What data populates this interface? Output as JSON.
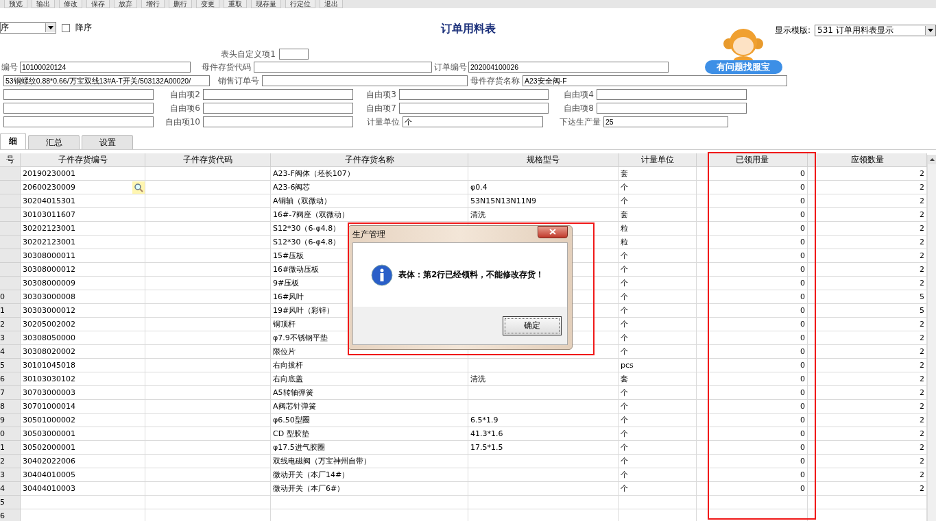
{
  "toolbar": [
    "预览",
    "输出",
    "修改",
    "保存",
    "放弃",
    "增行",
    "删行",
    "变更",
    "重取",
    "现存量",
    "行定位",
    "退出"
  ],
  "sort": {
    "value": "序"
  },
  "descending": {
    "label": "降序",
    "checked": false
  },
  "title": "订单用料表",
  "template": {
    "label": "显示模版:",
    "value": "531 订单用料表显示"
  },
  "help_button": "有问题找服宝",
  "header_fields": [
    [
      {
        "kind": "labeled",
        "label": "表头自定义项1"
      }
    ],
    [
      {
        "kind": "labeled",
        "label": "编号",
        "value": "10100020124"
      },
      {
        "kind": "labeled",
        "label": "母件存货代码"
      },
      {
        "kind": "labeled",
        "label": "订单编号",
        "value": "202004100026"
      }
    ],
    [
      {
        "kind": "bare",
        "value": "53铜螺纹0.88*0.66/万宝双线13#A-T开关/503132A00020/"
      },
      {
        "kind": "labeled",
        "label": "销售订单号"
      },
      {
        "kind": "labeled",
        "label": "母件存货名称",
        "value": "A23安全阀-F"
      }
    ],
    [
      {
        "kind": "bare"
      },
      {
        "kind": "labeled",
        "label": "自由项2"
      },
      {
        "kind": "labeled",
        "label": "自由项3"
      },
      {
        "kind": "labeled",
        "label": "自由项4"
      }
    ],
    [
      {
        "kind": "bare"
      },
      {
        "kind": "labeled",
        "label": "自由项6"
      },
      {
        "kind": "labeled",
        "label": "自由项7"
      },
      {
        "kind": "labeled",
        "label": "自由项8"
      }
    ],
    [
      {
        "kind": "bare"
      },
      {
        "kind": "labeled",
        "label": "自由项10"
      },
      {
        "kind": "labeled",
        "label": "计量单位",
        "value": "个"
      },
      {
        "kind": "labeled",
        "label": "下达生产量",
        "value": "25"
      }
    ]
  ],
  "tabs": [
    {
      "label": "细",
      "selected": true
    },
    {
      "label": "汇总",
      "selected": false
    },
    {
      "label": "设置",
      "selected": false
    }
  ],
  "table": {
    "columns": [
      "号",
      "子件存货编号",
      "子件存货代码",
      "子件存货名称",
      "规格型号",
      "计量单位",
      "已领用量",
      "应领数量"
    ],
    "rows": [
      {
        "code": "20190230001",
        "name": "A23-F阀体（坯长107）",
        "unit": "套",
        "issued": "0",
        "required": "2",
        "lookup": false
      },
      {
        "code": "20600230009",
        "name": "A23-6阀芯",
        "spec": "φ0.4",
        "unit": "个",
        "issued": "0",
        "required": "2",
        "lookup": true
      },
      {
        "code": "30204015301",
        "name": "A铜轴（双微动）",
        "spec": "53N15N13N11N9",
        "unit": "个",
        "issued": "0",
        "required": "2",
        "lookup": false
      },
      {
        "code": "30103011607",
        "name": "16#-7阀座（双微动）",
        "spec": "清洗",
        "unit": "套",
        "issued": "0",
        "required": "2",
        "lookup": false
      },
      {
        "code": "30202123001",
        "name": "S12*30（6-φ4.8）",
        "unit": "粒",
        "issued": "0",
        "required": "2",
        "lookup": false
      },
      {
        "code": "30202123001",
        "name": "S12*30（6-φ4.8）",
        "unit": "粒",
        "issued": "0",
        "required": "2",
        "lookup": false
      },
      {
        "code": "30308000011",
        "name": "15#压板",
        "unit": "个",
        "issued": "0",
        "required": "2",
        "lookup": false
      },
      {
        "code": "30308000012",
        "name": "16#微动压板",
        "unit": "个",
        "issued": "0",
        "required": "2",
        "lookup": false
      },
      {
        "code": "30308000009",
        "name": "9#压板",
        "unit": "个",
        "issued": "0",
        "required": "2",
        "lookup": false
      },
      {
        "row_number": "0",
        "code": "30303000008",
        "name": "16#风叶",
        "unit": "个",
        "issued": "0",
        "required": "5",
        "lookup": false
      },
      {
        "row_number": "1",
        "code": "30303000012",
        "name": "19#风叶（彩锌）",
        "unit": "个",
        "issued": "0",
        "required": "5",
        "lookup": false
      },
      {
        "row_number": "2",
        "code": "30205002002",
        "name": "铜顶杆",
        "unit": "个",
        "issued": "0",
        "required": "2",
        "lookup": false
      },
      {
        "row_number": "3",
        "code": "30308050000",
        "name": "φ7.9不锈钢平垫",
        "unit": "个",
        "issued": "0",
        "required": "2",
        "lookup": false
      },
      {
        "row_number": "4",
        "code": "30308020002",
        "name": "限位片",
        "unit": "个",
        "issued": "0",
        "required": "2",
        "lookup": false
      },
      {
        "row_number": "5",
        "code": "30101045018",
        "name": "右向拔杆",
        "unit": "pcs",
        "issued": "0",
        "required": "2",
        "lookup": false
      },
      {
        "row_number": "6",
        "code": "30103030102",
        "name": "右向底盖",
        "spec": "清洗",
        "unit": "套",
        "issued": "0",
        "required": "2",
        "lookup": false
      },
      {
        "row_number": "7",
        "code": "30703000003",
        "name": "A5转轴弹簧",
        "unit": "个",
        "issued": "0",
        "required": "2",
        "lookup": false
      },
      {
        "row_number": "8",
        "code": "30701000014",
        "name": "A阀芯针弹簧",
        "unit": "个",
        "issued": "0",
        "required": "2",
        "lookup": false
      },
      {
        "row_number": "9",
        "code": "30501000002",
        "name": "φ6.50型圈",
        "spec": "6.5*1.9",
        "unit": "个",
        "issued": "0",
        "required": "2",
        "lookup": false
      },
      {
        "row_number": "0",
        "code": "30503000001",
        "name": "CD 型胶垫",
        "spec": "41.3*1.6",
        "unit": "个",
        "issued": "0",
        "required": "2",
        "lookup": false
      },
      {
        "row_number": "1",
        "code": "30502000001",
        "name": "φ17.5进气胶圈",
        "spec": "17.5*1.5",
        "unit": "个",
        "issued": "0",
        "required": "2",
        "lookup": false
      },
      {
        "row_number": "2",
        "code": "30402022006",
        "name": "双线电磁阀（万宝神州自带）",
        "unit": "个",
        "issued": "0",
        "required": "2",
        "lookup": false
      },
      {
        "row_number": "3",
        "code": "30404010005",
        "name": "微动开关（本厂14#）",
        "unit": "个",
        "issued": "0",
        "required": "2",
        "lookup": false
      },
      {
        "row_number": "4",
        "code": "30404010003",
        "name": "微动开关（本厂6#）",
        "unit": "个",
        "issued": "0",
        "required": "2",
        "lookup": false
      },
      {
        "row_number": "5",
        "lookup": false
      },
      {
        "row_number": "6",
        "lookup": false
      }
    ]
  },
  "dialog": {
    "title": "生产管理",
    "message": "表体：第2行已经领料，不能修改存货！",
    "button": "确定"
  }
}
